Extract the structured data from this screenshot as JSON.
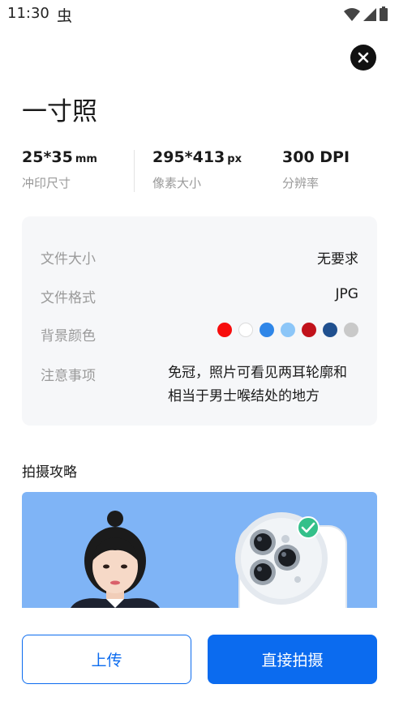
{
  "status_bar": {
    "time": "11:30",
    "notification_glyph": "虫",
    "icons": [
      "wifi-icon",
      "signal-icon",
      "battery-icon"
    ]
  },
  "header": {
    "title": "一寸照",
    "close_icon": "close-icon"
  },
  "specs": [
    {
      "value": "25*35",
      "unit": "mm",
      "label": "冲印尺寸"
    },
    {
      "value": "295*413",
      "unit": "px",
      "label": "像素大小"
    },
    {
      "value": "300 DPI",
      "unit": "",
      "label": "分辨率"
    }
  ],
  "info": {
    "file_size_label": "文件大小",
    "file_size_value": "无要求",
    "file_format_label": "文件格式",
    "file_format_value": "JPG",
    "background_label": "背景颜色",
    "background_colors": [
      "#f70d0d",
      "#ffffff",
      "#2f86e8",
      "#8cc6f8",
      "#c1121b",
      "#20508f",
      "#c9c9c9"
    ],
    "notes_label": "注意事项",
    "notes_value": "免冠，照片可看见两耳轮廓和相当于男士喉结处的地方"
  },
  "guide": {
    "title": "拍摄攻略",
    "image_icons": [
      "person-photo-icon",
      "phone-camera-icon",
      "check-badge-icon"
    ]
  },
  "actions": {
    "upload_label": "上传",
    "shoot_label": "直接拍摄"
  },
  "colors": {
    "accent": "#0b6bef",
    "card_bg": "#f6f7f9",
    "guide_bg": "#7fb4f6",
    "check": "#34c08a"
  }
}
